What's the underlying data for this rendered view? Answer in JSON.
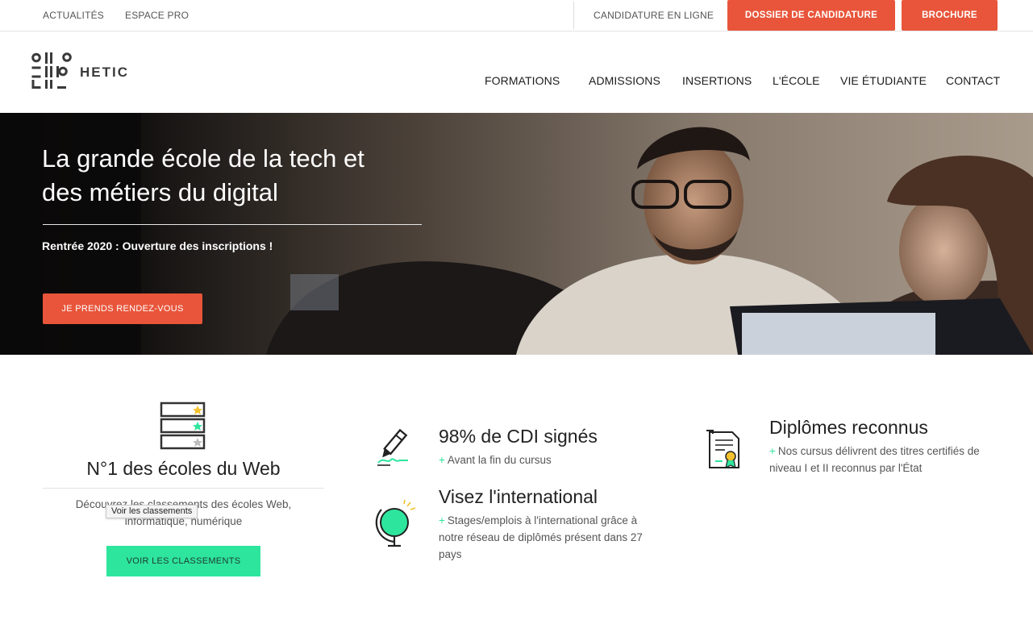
{
  "topbar": {
    "links": [
      "ACTUALITÉS",
      "ESPACE PRO"
    ],
    "candidature_link": "CANDIDATURE EN LIGNE",
    "dossier_button": "DOSSIER DE CANDIDATURE",
    "brochure_button": "BROCHURE"
  },
  "header": {
    "logo_text": "HETIC",
    "nav": [
      "FORMATIONS",
      "ADMISSIONS",
      "INSERTIONS",
      "L'ÉCOLE",
      "VIE ÉTUDIANTE",
      "CONTACT"
    ]
  },
  "hero": {
    "title_line1": "La grande école de la tech et",
    "title_line2": "des métiers du digital",
    "subtitle": "Rentrée 2020 : Ouverture des inscriptions !",
    "cta": "JE PRENDS RENDEZ-VOUS"
  },
  "ranking": {
    "title": "N°1 des écoles du Web",
    "desc_line1": "Découvrez les classements des écoles Web,",
    "desc_line2": "informatique, numérique",
    "tooltip": "Voir les classements",
    "button": "VOIR LES CLASSEMENTS"
  },
  "features": {
    "cdi": {
      "title": "98% de CDI signés",
      "text": "Avant la fin du cursus"
    },
    "international": {
      "title": "Visez l'international",
      "text_line1": "Stages/emplois à l'international grâce à",
      "text_line2": "notre réseau de diplômés présent dans 27",
      "text_line3": "pays"
    },
    "diplomes": {
      "title": "Diplômes reconnus",
      "text_line1": "Nos cursus délivrent des titres certifiés de",
      "text_line2": "niveau I et II reconnus par l'État"
    },
    "plus_symbol": "+"
  },
  "colors": {
    "accent_red": "#e8553a",
    "accent_green": "#2ee59d",
    "text_dark": "#222222"
  }
}
